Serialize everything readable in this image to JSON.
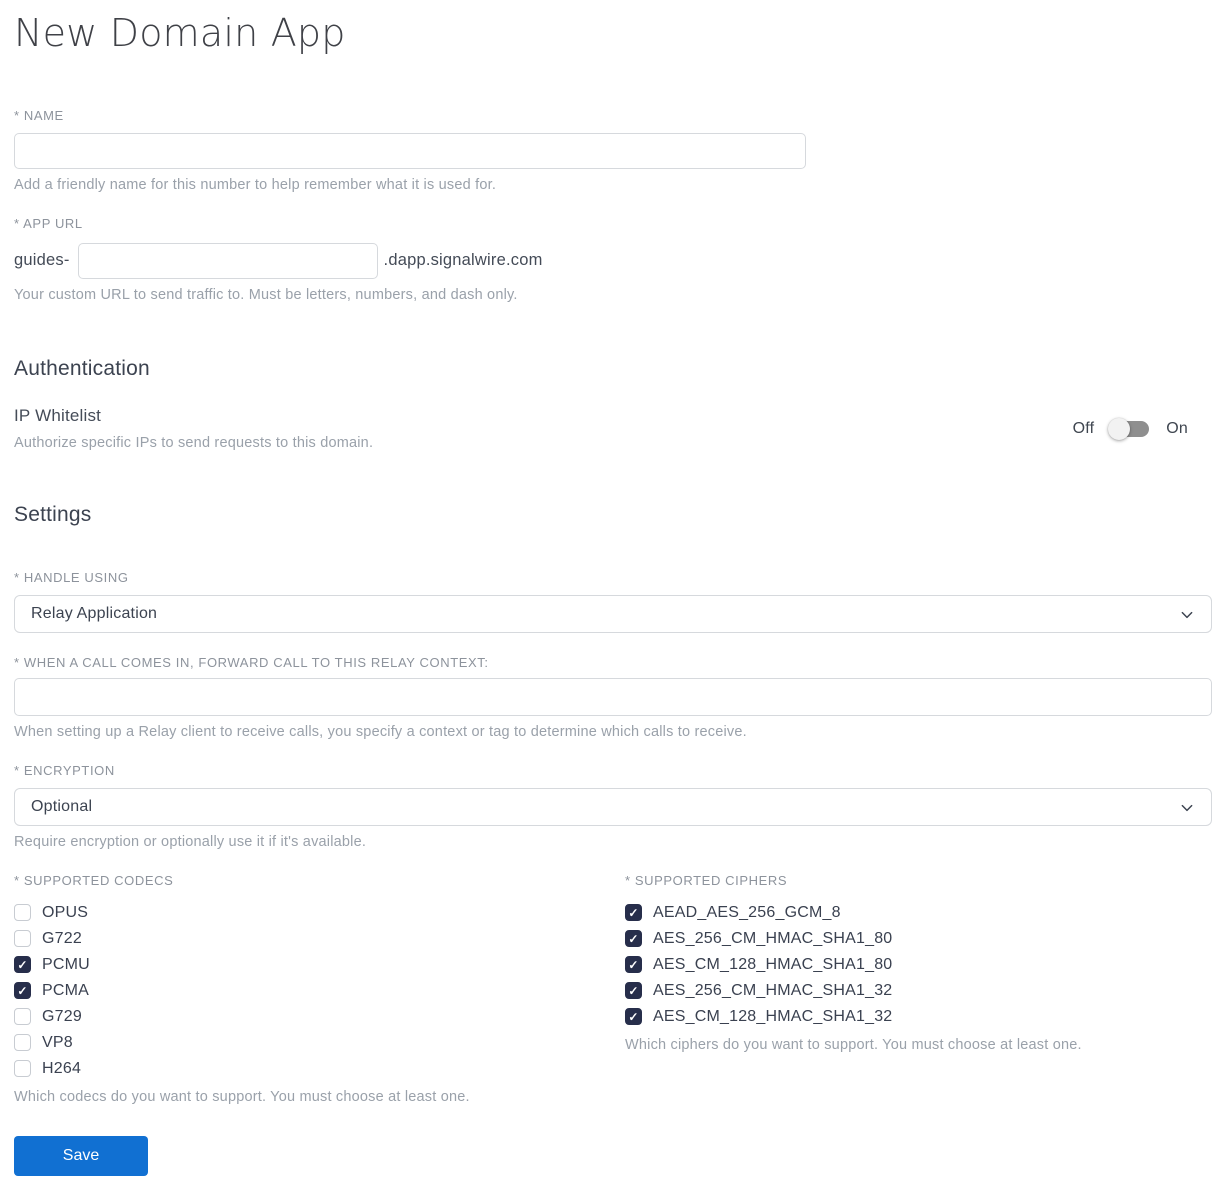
{
  "page": {
    "title": "New Domain App"
  },
  "name_field": {
    "label": "* NAME",
    "value": "",
    "help": "Add a friendly name for this number to help remember what it is used for."
  },
  "app_url_field": {
    "label": "* APP URL",
    "prefix": "guides-",
    "value": "",
    "suffix": ".dapp.signalwire.com",
    "help": "Your custom URL to send traffic to. Must be letters, numbers, and dash only."
  },
  "authentication": {
    "heading": "Authentication",
    "ip_whitelist": {
      "label": "IP Whitelist",
      "help": "Authorize specific IPs to send requests to this domain.",
      "off_label": "Off",
      "on_label": "On",
      "state": "off"
    }
  },
  "settings": {
    "heading": "Settings",
    "handle_using": {
      "label": "* HANDLE USING",
      "selected": "Relay Application"
    },
    "relay_context": {
      "label": "* WHEN A CALL COMES IN, FORWARD CALL TO THIS RELAY CONTEXT:",
      "value": "",
      "help": "When setting up a Relay client to receive calls, you specify a context or tag to determine which calls to receive."
    },
    "encryption": {
      "label": "* ENCRYPTION",
      "selected": "Optional",
      "help": "Require encryption or optionally use it if it's available."
    },
    "codecs": {
      "label": "* SUPPORTED CODECS",
      "options": [
        {
          "label": "OPUS",
          "checked": false
        },
        {
          "label": "G722",
          "checked": false
        },
        {
          "label": "PCMU",
          "checked": true
        },
        {
          "label": "PCMA",
          "checked": true
        },
        {
          "label": "G729",
          "checked": false
        },
        {
          "label": "VP8",
          "checked": false
        },
        {
          "label": "H264",
          "checked": false
        }
      ],
      "help": "Which codecs do you want to support. You must choose at least one."
    },
    "ciphers": {
      "label": "* SUPPORTED CIPHERS",
      "options": [
        {
          "label": "AEAD_AES_256_GCM_8",
          "checked": true
        },
        {
          "label": "AES_256_CM_HMAC_SHA1_80",
          "checked": true
        },
        {
          "label": "AES_CM_128_HMAC_SHA1_80",
          "checked": true
        },
        {
          "label": "AES_256_CM_HMAC_SHA1_32",
          "checked": true
        },
        {
          "label": "AES_CM_128_HMAC_SHA1_32",
          "checked": true
        }
      ],
      "help": "Which ciphers do you want to support. You must choose at least one."
    }
  },
  "actions": {
    "save_label": "Save"
  },
  "colors": {
    "primary_button": "#1170d2",
    "checkbox_checked": "#272e4b",
    "toggle_track": "#8f8f8f",
    "toggle_thumb": "#f2f2f2",
    "input_border": "#d6d9dd",
    "label_text": "#8d939c",
    "help_text": "#9aa1aa",
    "body_text": "#3f4753"
  }
}
